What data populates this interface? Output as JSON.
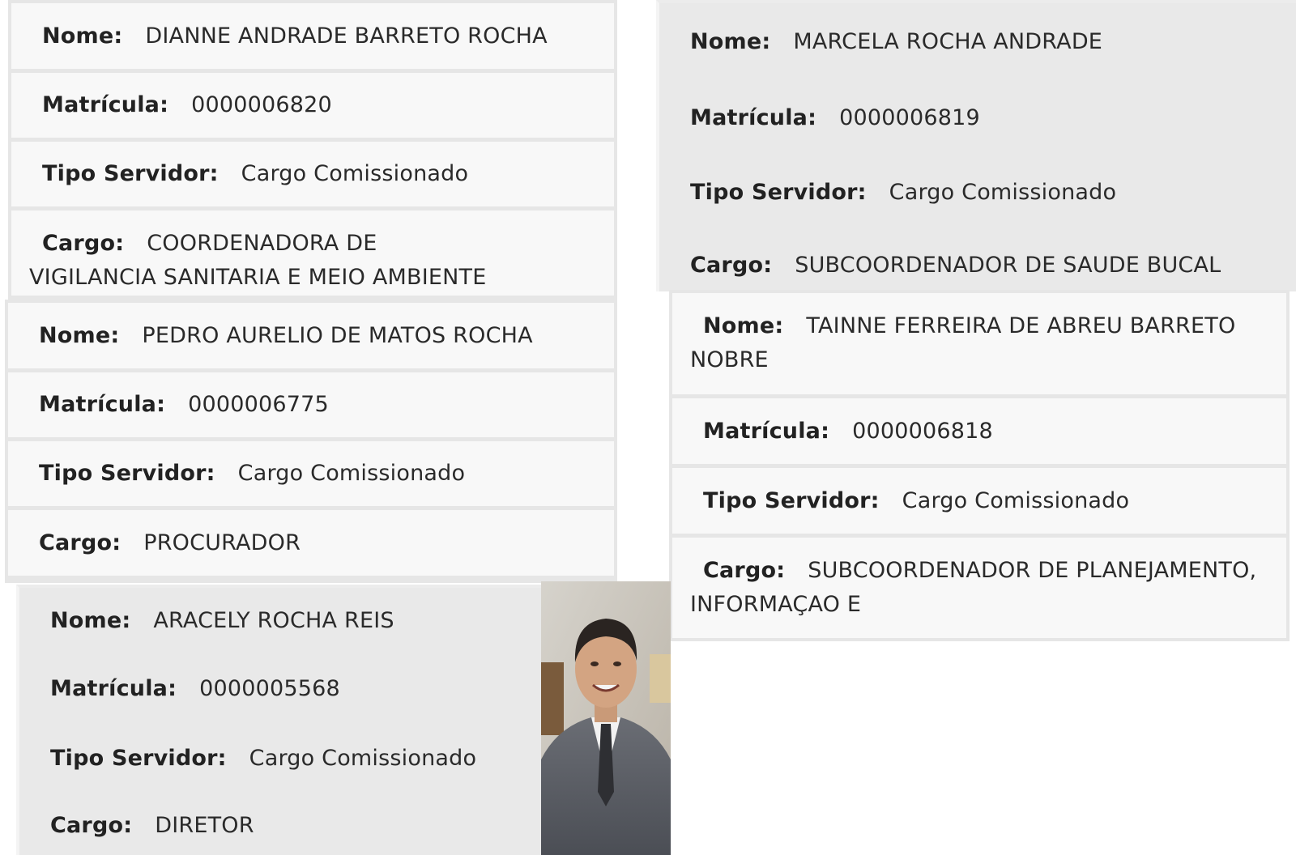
{
  "cards": [
    {
      "nome_label": "Nome:",
      "nome": "DIANNE ANDRADE BARRETO ROCHA",
      "matricula_label": "Matrícula:",
      "matricula": "0000006820",
      "tipo_label": "Tipo Servidor:",
      "tipo": "Cargo Comissionado",
      "cargo_label": "Cargo:",
      "cargo": "COORDENADORA DE VIGILANCIA SANITARIA E MEIO AMBIENTE"
    },
    {
      "nome_label": "Nome:",
      "nome": "MARCELA ROCHA ANDRADE",
      "matricula_label": "Matrícula:",
      "matricula": "0000006819",
      "tipo_label": "Tipo Servidor:",
      "tipo": "Cargo Comissionado",
      "cargo_label": "Cargo:",
      "cargo": "SUBCOORDENADOR DE SAUDE BUCAL"
    },
    {
      "nome_label": "Nome:",
      "nome": "PEDRO AURELIO DE MATOS ROCHA",
      "matricula_label": "Matrícula:",
      "matricula": "0000006775",
      "tipo_label": "Tipo Servidor:",
      "tipo": "Cargo Comissionado",
      "cargo_label": "Cargo:",
      "cargo": "PROCURADOR"
    },
    {
      "nome_label": "Nome:",
      "nome": "TAINNE FERREIRA DE ABREU BARRETO NOBRE",
      "matricula_label": "Matrícula:",
      "matricula": "0000006818",
      "tipo_label": "Tipo Servidor:",
      "tipo": "Cargo Comissionado",
      "cargo_label": "Cargo:",
      "cargo": "SUBCOORDENADOR DE PLANEJAMENTO, INFORMAÇAO E"
    },
    {
      "nome_label": "Nome:",
      "nome": "ARACELY ROCHA REIS",
      "matricula_label": "Matrícula:",
      "matricula": "0000005568",
      "tipo_label": "Tipo Servidor:",
      "tipo": "Cargo Comissionado",
      "cargo_label": "Cargo:",
      "cargo": "DIRETOR"
    }
  ],
  "photo": {
    "subject": "man-in-suit-portrait"
  }
}
